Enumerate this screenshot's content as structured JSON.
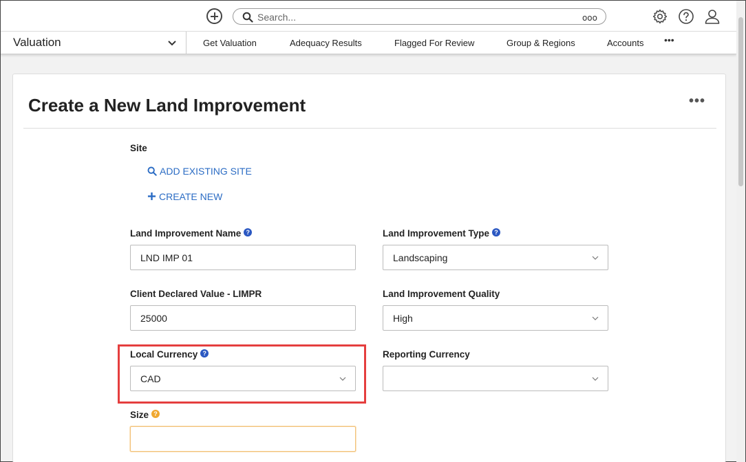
{
  "topbar": {
    "search_placeholder": "Search...",
    "search_options_icon": "ooo",
    "icons": [
      "add-circle-icon",
      "search-icon",
      "gear-icon",
      "help-icon",
      "user-icon"
    ]
  },
  "nav": {
    "app_title": "Valuation",
    "items": [
      {
        "label": "Get Valuation"
      },
      {
        "label": "Adequacy Results"
      },
      {
        "label": "Flagged For Review"
      },
      {
        "label": "Group & Regions"
      },
      {
        "label": "Accounts"
      }
    ],
    "more": "•••"
  },
  "page": {
    "title": "Create a New Land Improvement",
    "menu": "•••"
  },
  "form": {
    "site_label": "Site",
    "add_existing_site": "ADD EXISTING SITE",
    "create_new": "CREATE NEW",
    "land_improvement_name": {
      "label": "Land Improvement Name",
      "value": "LND IMP 01"
    },
    "land_improvement_type": {
      "label": "Land Improvement Type",
      "value": "Landscaping"
    },
    "client_declared_value": {
      "label": "Client Declared Value - LIMPR",
      "value": "25000"
    },
    "land_improvement_quality": {
      "label": "Land Improvement Quality",
      "value": "High"
    },
    "local_currency": {
      "label": "Local Currency",
      "value": "CAD"
    },
    "reporting_currency": {
      "label": "Reporting Currency",
      "value": ""
    },
    "size": {
      "label": "Size",
      "value": ""
    },
    "help_glyph": "?"
  },
  "colors": {
    "link": "#2b6cc4",
    "help_badge": "#2b58c2",
    "warn_badge": "#f0a830",
    "highlight": "#e53e3e"
  }
}
